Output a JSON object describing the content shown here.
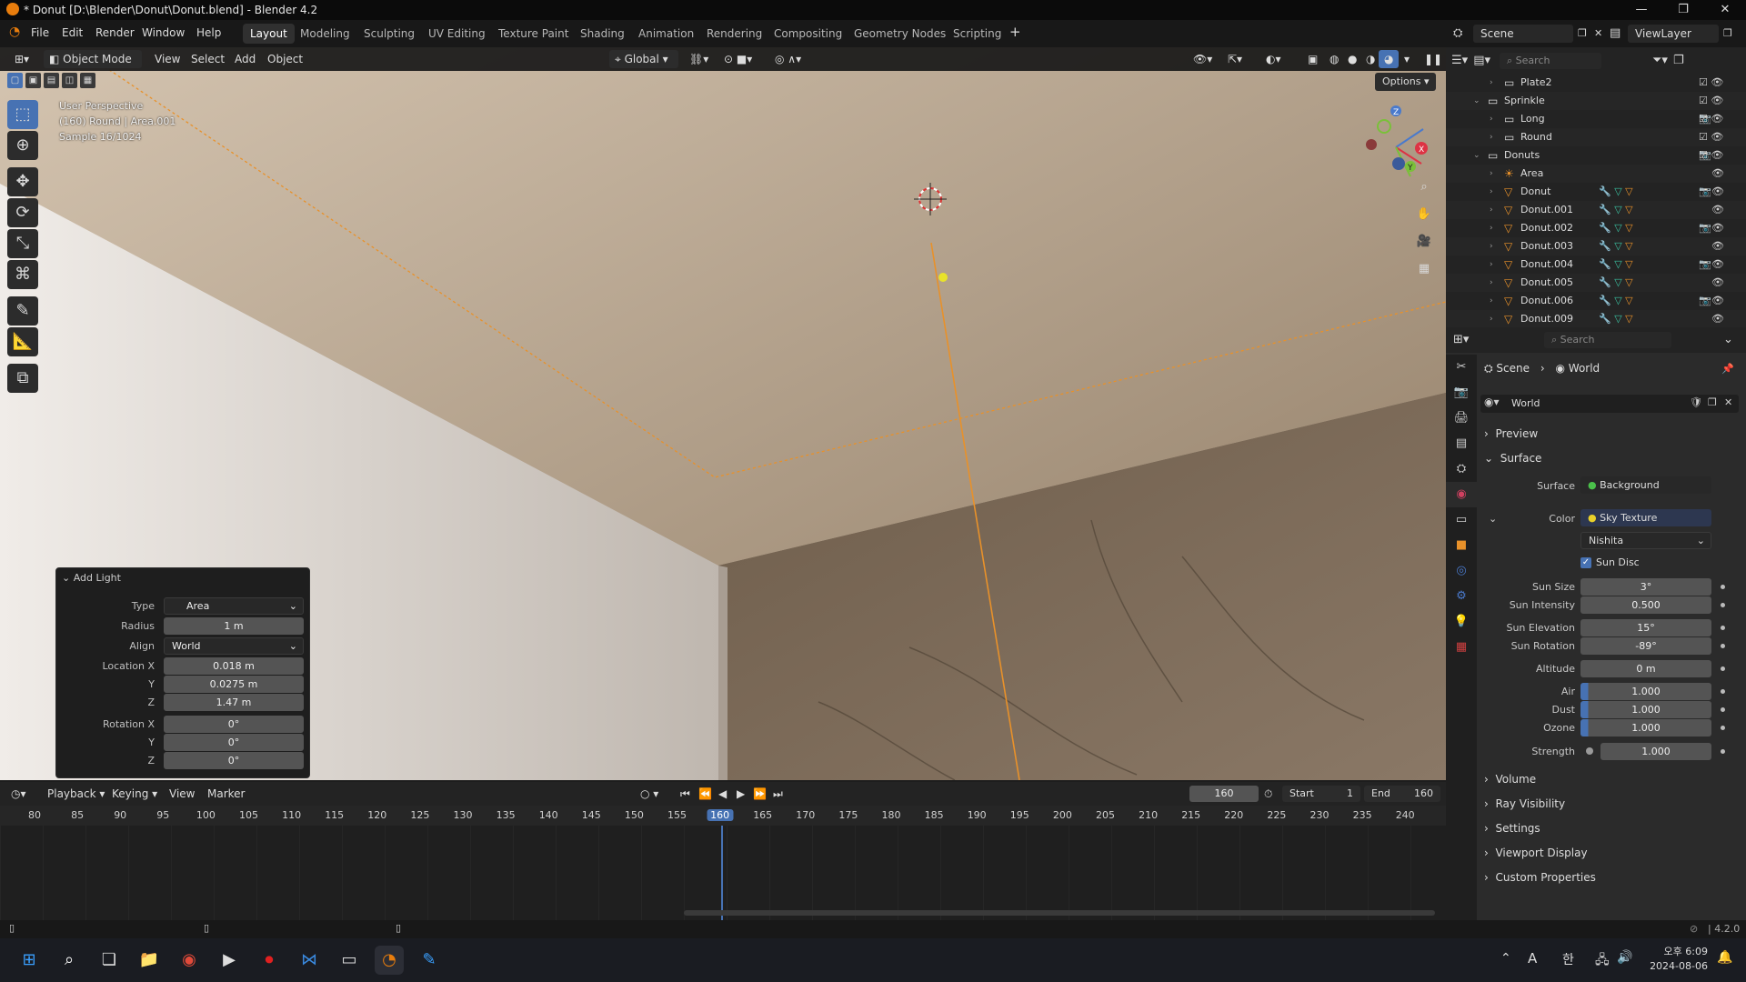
{
  "window": {
    "title": "* Donut [D:\\Blender\\Donut\\Donut.blend] - Blender 4.2"
  },
  "menus": [
    "File",
    "Edit",
    "Render",
    "Window",
    "Help"
  ],
  "workspaces": [
    "Layout",
    "Modeling",
    "Sculpting",
    "UV Editing",
    "Texture Paint",
    "Shading",
    "Animation",
    "Rendering",
    "Compositing",
    "Geometry Nodes",
    "Scripting"
  ],
  "scene": {
    "name": "Scene",
    "view_layer": "ViewLayer"
  },
  "viewport": {
    "mode": "Object Mode",
    "menus": [
      "View",
      "Select",
      "Add",
      "Object"
    ],
    "transform_orientation": "Global",
    "options_label": "Options",
    "overlay_lines": [
      "User Perspective",
      "(160) Round | Area.001",
      "Sample 16/1024"
    ]
  },
  "add_light": {
    "title": "Add Light",
    "type_label": "Type",
    "type_value": "Area",
    "radius_label": "Radius",
    "radius_value": "1 m",
    "align_label": "Align",
    "align_value": "World",
    "location_label": "Location X",
    "loc_x": "0.018 m",
    "y_label": "Y",
    "loc_y": "0.0275 m",
    "z_label": "Z",
    "loc_z": "1.47 m",
    "rotation_label": "Rotation X",
    "rot_x": "0°",
    "rot_y": "0°",
    "rot_z": "0°"
  },
  "timeline": {
    "menus": [
      "Playback",
      "Keying",
      "View",
      "Marker"
    ],
    "current_frame": "160",
    "start_label": "Start",
    "start": "1",
    "end_label": "End",
    "end": "160",
    "ticks": [
      "80",
      "85",
      "90",
      "95",
      "100",
      "105",
      "110",
      "115",
      "120",
      "125",
      "130",
      "135",
      "140",
      "145",
      "150",
      "155",
      "160",
      "165",
      "170",
      "175",
      "180",
      "185",
      "190",
      "195",
      "200",
      "205",
      "210",
      "215",
      "220",
      "225",
      "230",
      "235",
      "240"
    ]
  },
  "outliner": {
    "search_placeholder": "Search",
    "rows": [
      {
        "name": "Plate2",
        "indent": 2,
        "kind": "collection"
      },
      {
        "name": "Sprinkle",
        "indent": 1,
        "kind": "collection"
      },
      {
        "name": "Long",
        "indent": 2,
        "kind": "collection"
      },
      {
        "name": "Round",
        "indent": 2,
        "kind": "collection"
      },
      {
        "name": "Donuts",
        "indent": 1,
        "kind": "collection"
      },
      {
        "name": "Area",
        "indent": 2,
        "kind": "light"
      },
      {
        "name": "Donut",
        "indent": 2,
        "kind": "mesh"
      },
      {
        "name": "Donut.001",
        "indent": 2,
        "kind": "mesh"
      },
      {
        "name": "Donut.002",
        "indent": 2,
        "kind": "mesh"
      },
      {
        "name": "Donut.003",
        "indent": 2,
        "kind": "mesh"
      },
      {
        "name": "Donut.004",
        "indent": 2,
        "kind": "mesh"
      },
      {
        "name": "Donut.005",
        "indent": 2,
        "kind": "mesh"
      },
      {
        "name": "Donut.006",
        "indent": 2,
        "kind": "mesh"
      },
      {
        "name": "Donut.009",
        "indent": 2,
        "kind": "mesh"
      }
    ]
  },
  "properties": {
    "search_placeholder": "Search",
    "breadcrumb_scene": "Scene",
    "breadcrumb_world": "World",
    "world_name": "World",
    "sections": {
      "preview": "Preview",
      "surface": "Surface",
      "volume": "Volume",
      "ray_visibility": "Ray Visibility",
      "settings": "Settings",
      "viewport_display": "Viewport Display",
      "custom_properties": "Custom Properties"
    },
    "surface_label": "Surface",
    "surface_value": "Background",
    "color_label": "Color",
    "color_value": "Sky Texture",
    "sky_type": "Nishita",
    "sun_disc_label": "Sun Disc",
    "fields": [
      {
        "label": "Sun Size",
        "value": "3°"
      },
      {
        "label": "Sun Intensity",
        "value": "0.500"
      },
      {
        "label": "Sun Elevation",
        "value": "15°"
      },
      {
        "label": "Sun Rotation",
        "value": "-89°"
      },
      {
        "label": "Altitude",
        "value": "0 m"
      },
      {
        "label": "Air",
        "value": "1.000"
      },
      {
        "label": "Dust",
        "value": "1.000"
      },
      {
        "label": "Ozone",
        "value": "1.000"
      },
      {
        "label": "Strength",
        "value": "1.000"
      }
    ]
  },
  "status": {
    "version": "4.2.0"
  },
  "taskbar": {
    "ime": "A",
    "ime2": "한",
    "time": "오후 6:09",
    "date": "2024-08-06"
  },
  "colors": {
    "accent": "#4772b3",
    "selection": "#e8912a",
    "orange_ui": "#e87d0d"
  }
}
